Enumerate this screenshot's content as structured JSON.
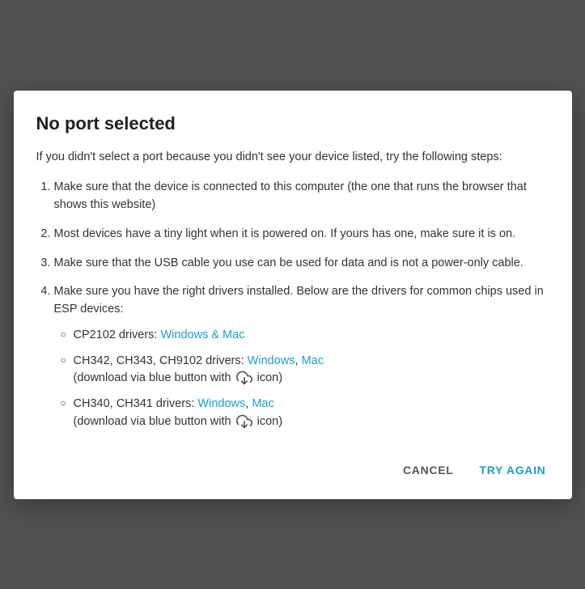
{
  "dialog": {
    "title": "No port selected",
    "intro": "If you didn't select a port because you didn't see your device listed, try the following steps:",
    "steps": [
      {
        "text": "Make sure that the device is connected to this computer (the one that runs the browser that shows this website)"
      },
      {
        "text": "Most devices have a tiny light when it is powered on. If yours has one, make sure it is on."
      },
      {
        "text": "Make sure that the USB cable you use can be used for data and is not a power-only cable."
      },
      {
        "text": "Make sure you have the right drivers installed. Below are the drivers for common chips used in ESP devices:",
        "subItems": [
          {
            "prefix": "CP2102 drivers: ",
            "links": [
              {
                "label": "Windows & Mac",
                "href": "#"
              }
            ],
            "suffix": ""
          },
          {
            "prefix": "CH342, CH343, CH9102 drivers: ",
            "links": [
              {
                "label": "Windows",
                "href": "#"
              },
              {
                "separator": ", "
              },
              {
                "label": "Mac",
                "href": "#"
              }
            ],
            "suffix": "(download via blue button with",
            "hasSuffixIcon": true,
            "suffixEnd": "icon)"
          },
          {
            "prefix": "CH340, CH341 drivers: ",
            "links": [
              {
                "label": "Windows",
                "href": "#"
              },
              {
                "separator": ", "
              },
              {
                "label": "Mac",
                "href": "#"
              }
            ],
            "suffix": "(download via blue button with",
            "hasSuffixIcon": true,
            "suffixEnd": "icon)"
          }
        ]
      }
    ],
    "actions": {
      "cancel_label": "CANCEL",
      "try_again_label": "TRY AGAIN"
    }
  }
}
